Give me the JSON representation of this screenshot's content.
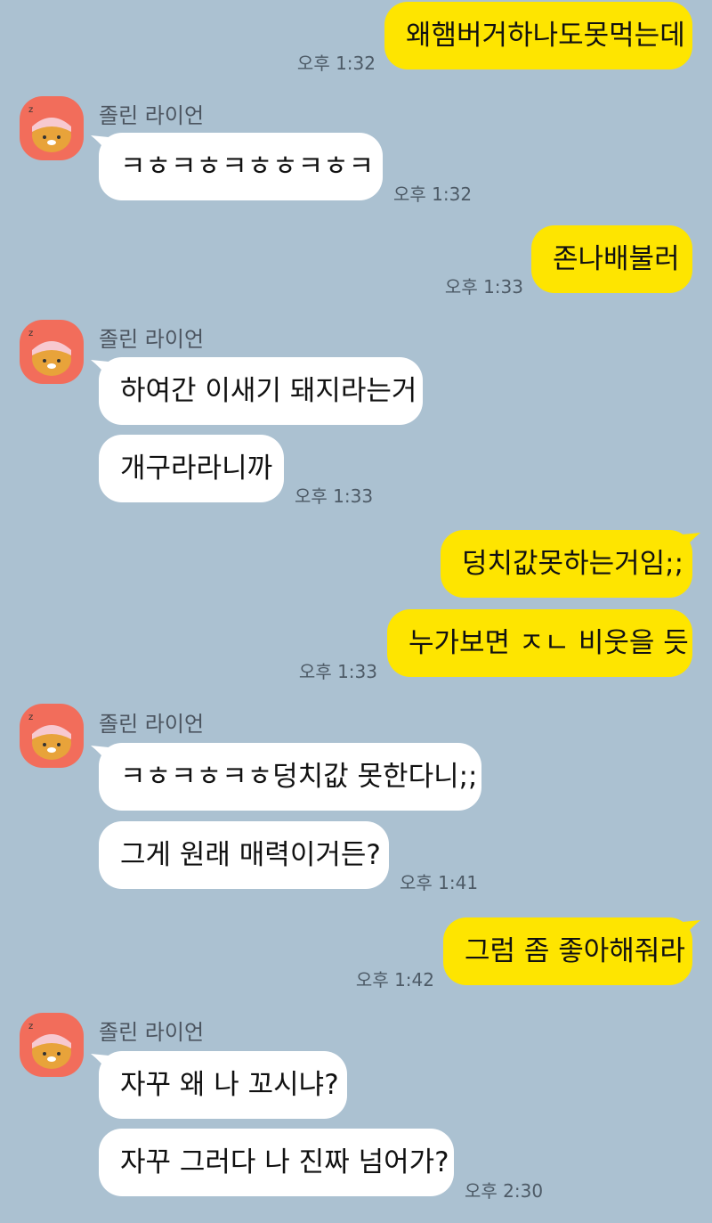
{
  "chat": {
    "contact_name": "졸린 라이언",
    "avatar_icon": "sleepy-ryan-avatar-icon",
    "messages": [
      {
        "text": "왜햄버거하나도못먹는데",
        "time": "오후 1:32"
      },
      {
        "text": "ㅋㅎㅋㅎㅋㅎㅎㅋㅎㅋ",
        "time": "오후 1:32"
      },
      {
        "text": "존나배불러",
        "time": "오후 1:33"
      },
      {
        "text": "하여간 이새기 돼지라는거"
      },
      {
        "text": "개구라라니까",
        "time": "오후 1:33"
      },
      {
        "text": "덩치값못하는거임;;"
      },
      {
        "text": "누가보면 ㅈㄴ 비웃을 듯",
        "time": "오후 1:33"
      },
      {
        "text": "ㅋㅎㅋㅎㅋㅎ덩치값 못한다니;;"
      },
      {
        "text": "그게 원래 매력이거든?",
        "time": "오후 1:41"
      },
      {
        "text": "그럼 좀 좋아해줘라",
        "time": "오후 1:42"
      },
      {
        "text": "자꾸 왜 나 꼬시냐?"
      },
      {
        "text": "자꾸 그러다 나 진짜 넘어가?",
        "time": "오후 2:30"
      }
    ]
  },
  "colors": {
    "background": "#abc1d1",
    "my_bubble": "#fee500",
    "their_bubble": "#ffffff",
    "avatar_bg": "#f26d5b"
  }
}
